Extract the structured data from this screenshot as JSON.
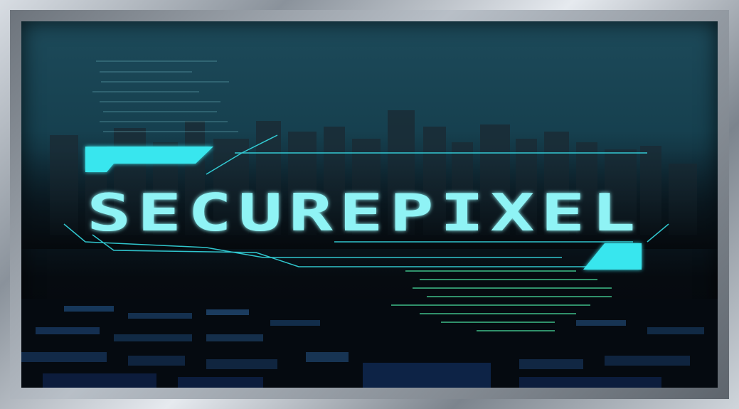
{
  "brand": {
    "logo_text": "SECUREPIXEL",
    "accent_color": "#38e6ee",
    "text_color": "#8ff3f5"
  },
  "icons": {
    "frame": "metal-frame",
    "skyline": "city-skyline-icon"
  }
}
